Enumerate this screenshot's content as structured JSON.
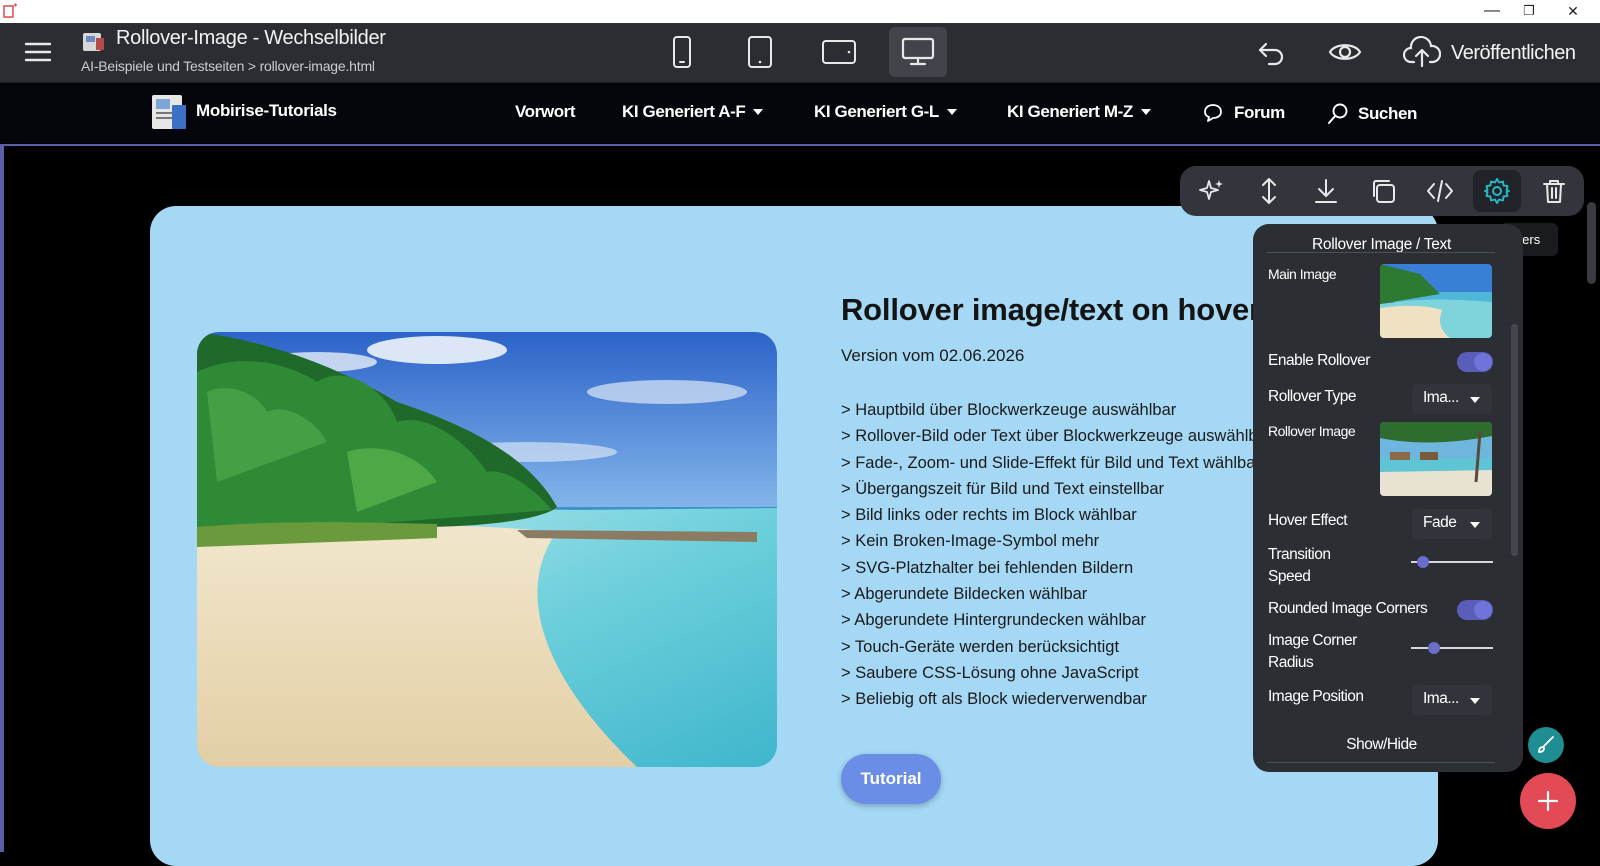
{
  "window": {
    "minimize_glyph": "—",
    "maximize_glyph": "❐",
    "close_glyph": "✕"
  },
  "editor": {
    "title": "Rollover-Image - Wechselbilder",
    "breadcrumb": "AI-Beispiele und Testseiten > rollover-image.html",
    "devices": [
      "phone-icon",
      "tablet-icon",
      "tablet-landscape-icon",
      "desktop-icon"
    ],
    "active_device": "desktop",
    "publish_label": "Veröffentlichen"
  },
  "site_nav": {
    "brand": "Mobirise-Tutorials",
    "items": [
      {
        "label": "Vorwort",
        "dropdown": false
      },
      {
        "label": "KI Generiert A-F",
        "dropdown": true
      },
      {
        "label": "KI Generiert G-L",
        "dropdown": true
      },
      {
        "label": "KI Generiert M-Z",
        "dropdown": true
      },
      {
        "label": "Forum",
        "icon": "chat-icon"
      },
      {
        "label": "Suchen",
        "icon": "search-icon"
      }
    ]
  },
  "content": {
    "heading": "Rollover image/text on hover",
    "version": "Version vom 02.06.2026",
    "features": [
      "> Hauptbild über Blockwerkzeuge auswählbar",
      "> Rollover-Bild oder Text über Blockwerkzeuge auswählbar",
      "> Fade-, Zoom- und Slide-Effekt für Bild und Text wählbar",
      "> Übergangszeit für Bild und Text einstellbar",
      "> Bild links oder rechts im Block wählbar",
      "> Kein Broken-Image-Symbol mehr",
      "> SVG-Platzhalter bei fehlenden Bildern",
      "> Abgerundete Bildecken wählbar",
      "> Abgerundete Hintergrundecken wählbar",
      "> Touch-Geräte werden berücksichtigt",
      "> Saubere CSS-Lösung ohne JavaScript",
      "> Beliebig oft als Block wiederverwendbar"
    ],
    "button_label": "Tutorial",
    "card_color": "#a4d8f5",
    "button_color": "#6a8ee6"
  },
  "block_toolbar": {
    "tools": [
      "ai-sparkle-icon",
      "move-icon",
      "download-icon",
      "duplicate-icon",
      "code-icon",
      "gear-icon",
      "trash-icon"
    ],
    "active_tool": "gear-icon",
    "tooltip": "Parameters"
  },
  "parameters": {
    "title": "Rollover Image / Text",
    "main_image_label": "Main Image",
    "enable_rollover_label": "Enable Rollover",
    "enable_rollover": true,
    "rollover_type_label": "Rollover Type",
    "rollover_type_value": "Ima...",
    "rollover_image_label": "Rollover Image",
    "hover_effect_label": "Hover Effect",
    "hover_effect_value": "Fade",
    "transition_speed_label_1": "Transition",
    "transition_speed_label_2": "Speed",
    "transition_speed_level": 0.15,
    "rounded_corners_label": "Rounded Image Corners",
    "rounded_corners": true,
    "corner_radius_label_1": "Image Corner",
    "corner_radius_label_2": "Radius",
    "corner_radius_level": 0.28,
    "image_position_label": "Image Position",
    "image_position_value": "Ima...",
    "show_hide_label": "Show/Hide",
    "accent_color": "#5a5dba"
  },
  "fabs": {
    "edit_color": "#1f8e92",
    "add_color": "#e24a55"
  }
}
